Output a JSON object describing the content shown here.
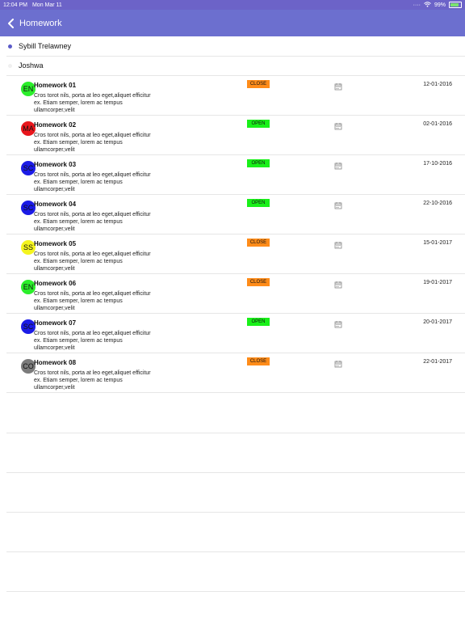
{
  "status_bar": {
    "time": "12:04 PM",
    "date": "Mon Mar 11",
    "battery": "99%"
  },
  "nav": {
    "title": "Homework"
  },
  "colors": {
    "nav_bg": "#6c6fcf",
    "status_bg": "#6c63c8",
    "close_badge": "#ff8c19",
    "open_badge": "#19f019"
  },
  "students": [
    {
      "name": "Sybill Trelawney",
      "selected": true
    },
    {
      "name": "Joshwa",
      "selected": false
    }
  ],
  "homework": [
    {
      "avatar": "EN",
      "avatar_color": "#2bee2b",
      "title": "Homework 01",
      "description": "Cros torot nils, porta at leo eget,aliquet efficitur ex. Etiam semper, lorem ac tempus ullamcorper,velit",
      "status": "CLOSE",
      "date": "12-01-2016"
    },
    {
      "avatar": "MA",
      "avatar_color": "#e8161c",
      "title": "Homework 02",
      "description": "Cros torot nils, porta at leo eget,aliquet efficitur ex. Etiam semper, lorem ac tempus ullamcorper,velit",
      "status": "OPEN",
      "date": "02-01-2016"
    },
    {
      "avatar": "SC",
      "avatar_color": "#1b1be6",
      "title": "Homework 03",
      "description": "Cros torot nils, porta at leo eget,aliquet efficitur ex. Etiam semper, lorem ac tempus ullamcorper,velit",
      "status": "OPEN",
      "date": "17-10-2016"
    },
    {
      "avatar": "SC",
      "avatar_color": "#1b1be6",
      "title": "Homework 04",
      "description": "Cros torot nils, porta at leo eget,aliquet efficitur ex. Etiam semper, lorem ac tempus ullamcorper,velit",
      "status": "OPEN",
      "date": "22-10-2016"
    },
    {
      "avatar": "SS",
      "avatar_color": "#f4f41e",
      "title": "Homework 05",
      "description": "Cros torot nils, porta at leo eget,aliquet efficitur ex. Etiam semper, lorem ac tempus ullamcorper,velit",
      "status": "CLOSE",
      "date": "15-01-2017"
    },
    {
      "avatar": "EN",
      "avatar_color": "#2bee2b",
      "title": "Homework 06",
      "description": "Cros torot nils, porta at leo eget,aliquet efficitur ex. Etiam semper, lorem ac tempus ullamcorper,velit",
      "status": "CLOSE",
      "date": "19-01-2017"
    },
    {
      "avatar": "SC",
      "avatar_color": "#1b1be6",
      "title": "Homework 07",
      "description": "Cros torot nils, porta at leo eget,aliquet efficitur ex. Etiam semper, lorem ac tempus ullamcorper,velit",
      "status": "OPEN",
      "date": "20-01-2017"
    },
    {
      "avatar": "CO",
      "avatar_color": "#7b7b7b",
      "title": "Homework 08",
      "description": "Cros torot nils, porta at leo eget,aliquet efficitur ex. Etiam semper, lorem ac tempus ullamcorper,velit",
      "status": "CLOSE",
      "date": "22-01-2017"
    }
  ],
  "icons": {
    "back": "chevron-left-icon",
    "calendar": "calendar-icon",
    "wifi": "wifi-icon",
    "battery": "battery-icon"
  }
}
